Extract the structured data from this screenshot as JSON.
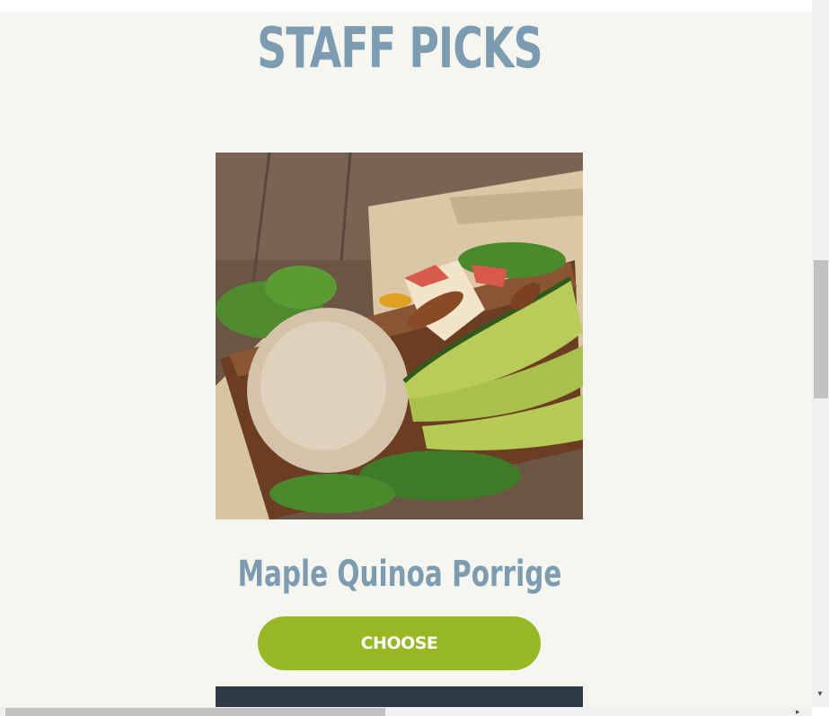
{
  "section": {
    "title": "STAFF PICKS"
  },
  "product": {
    "name": "Maple Quinoa Porrige",
    "image": "quinoa-avocado-salad-bowl",
    "choose_label": "CHOOSE"
  },
  "colors": {
    "title": "#7c9cb1",
    "button": "#97b823",
    "background": "#f5f6ef"
  },
  "scrollbar": {
    "down_icon": "▾",
    "right_icon": "▸"
  }
}
